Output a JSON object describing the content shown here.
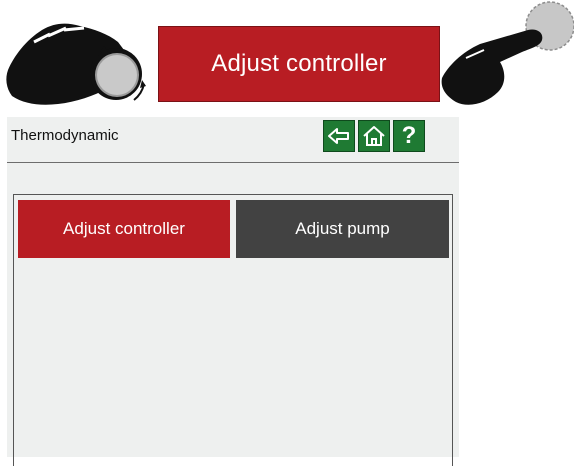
{
  "callout": {
    "button_label": "Adjust controller"
  },
  "screen": {
    "title": "Thermodynamic",
    "nav": {
      "back_icon": "back-arrow-icon",
      "home_icon": "home-icon",
      "help_label": "?"
    },
    "tabs": [
      {
        "label": "Adjust controller",
        "active": true
      },
      {
        "label": "Adjust pump",
        "active": false
      }
    ]
  },
  "colors": {
    "accent_red": "#b81d23",
    "nav_green": "#1f7a33",
    "inactive_tab": "#424242",
    "screen_bg": "#eef0ef"
  }
}
